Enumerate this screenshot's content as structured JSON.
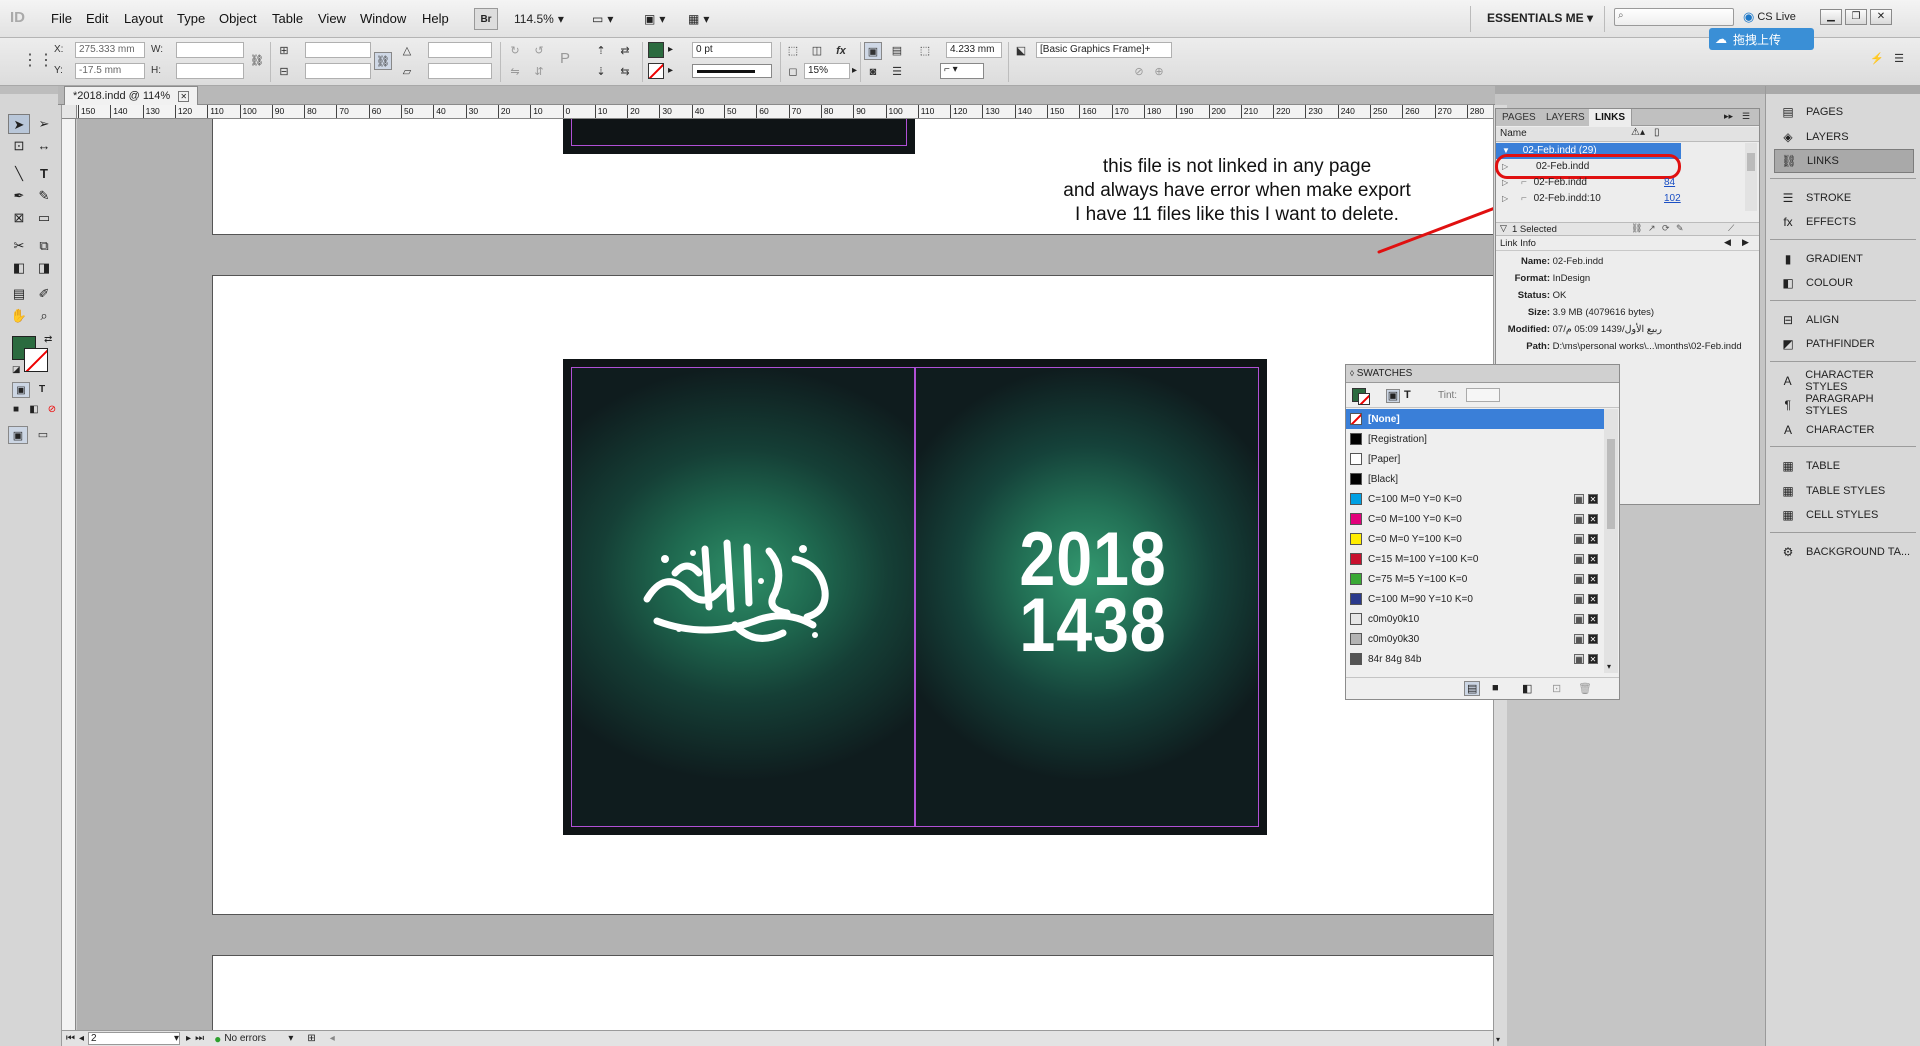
{
  "app": {
    "logo": "ID",
    "menus": [
      "File",
      "Edit",
      "Layout",
      "Type",
      "Object",
      "Table",
      "View",
      "Window",
      "Help"
    ],
    "bridge": "Br",
    "zoom": "114.5%",
    "workspace": "ESSENTIALS ME",
    "cs_live": "CS Live",
    "upload_popup": "拖拽上传"
  },
  "control": {
    "x_label": "X:",
    "x_value": "275.333 mm",
    "y_label": "Y:",
    "y_value": "-17.5 mm",
    "w_label": "W:",
    "h_label": "H:",
    "stroke_weight": "0 pt",
    "opacity": "15%",
    "offset": "4.233 mm",
    "object_style": "[Basic Graphics Frame]+"
  },
  "document": {
    "tab_title": "*2018.indd @ 114%",
    "ruler_labels": [
      "150",
      "140",
      "130",
      "120",
      "110",
      "100",
      "90",
      "80",
      "70",
      "60",
      "50",
      "40",
      "30",
      "20",
      "10",
      "0",
      "10",
      "20",
      "30",
      "40",
      "50",
      "60",
      "70",
      "80",
      "90",
      "100",
      "110",
      "120",
      "130",
      "140",
      "150",
      "160",
      "170",
      "180",
      "190",
      "200",
      "210",
      "220",
      "230",
      "240",
      "250",
      "260",
      "270",
      "280"
    ],
    "year_line1": "2018",
    "year_line2": "1438",
    "annotation": [
      "this file is not linked in any page",
      "and always have error when make export",
      "I have 11 files like this I want to delete."
    ]
  },
  "status": {
    "page": "2",
    "errors": "No errors"
  },
  "links_panel": {
    "tabs": [
      "PAGES",
      "LAYERS",
      "LINKS"
    ],
    "column_name": "Name",
    "rows": [
      {
        "name": "02-Feb.indd (29)",
        "page": "",
        "selected": true,
        "expanded": true
      },
      {
        "name": "02-Feb.indd",
        "page": "",
        "selected": false,
        "circled": true
      },
      {
        "name": "02-Feb.indd",
        "page": "84",
        "selected": false
      },
      {
        "name": "02-Feb.indd:10",
        "page": "102",
        "selected": false
      }
    ],
    "selected_count": "1 Selected",
    "info_title": "Link Info",
    "info": [
      {
        "label": "Name:",
        "value": "02-Feb.indd"
      },
      {
        "label": "Format:",
        "value": "InDesign"
      },
      {
        "label": "Status:",
        "value": "OK"
      },
      {
        "label": "Size:",
        "value": "3.9 MB (4079616 bytes)"
      },
      {
        "label": "Modified:",
        "value": "07/ربيع الأول/1439 05:09 م"
      },
      {
        "label": "Path:",
        "value": "D:\\ms\\personal works\\...\\months\\02-Feb.indd"
      }
    ]
  },
  "swatches_panel": {
    "title": "SWATCHES",
    "tint_label": "Tint:",
    "items": [
      {
        "name": "[None]",
        "color": "#ffffff",
        "selected": true
      },
      {
        "name": "[Registration]",
        "color": "#000000"
      },
      {
        "name": "[Paper]",
        "color": "#ffffff"
      },
      {
        "name": "[Black]",
        "color": "#000000"
      },
      {
        "name": "C=100 M=0 Y=0 K=0",
        "color": "#00a0e3"
      },
      {
        "name": "C=0 M=100 Y=0 K=0",
        "color": "#e2007a"
      },
      {
        "name": "C=0 M=0 Y=100 K=0",
        "color": "#ffec00"
      },
      {
        "name": "C=15 M=100 Y=100 K=0",
        "color": "#c8102e"
      },
      {
        "name": "C=75 M=5 Y=100 K=0",
        "color": "#3aa935"
      },
      {
        "name": "C=100 M=90 Y=10 K=0",
        "color": "#2a3a8c"
      },
      {
        "name": "c0m0y0k10",
        "color": "#e6e6e6"
      },
      {
        "name": "c0m0y0k30",
        "color": "#b3b3b3"
      },
      {
        "name": "84r 84g 84b",
        "color": "#545454"
      }
    ]
  },
  "dock": {
    "items": [
      "PAGES",
      "LAYERS",
      "LINKS",
      "STROKE",
      "EFFECTS",
      "GRADIENT",
      "COLOUR",
      "ALIGN",
      "PATHFINDER",
      "CHARACTER STYLES",
      "PARAGRAPH STYLES",
      "CHARACTER",
      "TABLE",
      "TABLE STYLES",
      "CELL STYLES",
      "BACKGROUND TA..."
    ]
  }
}
